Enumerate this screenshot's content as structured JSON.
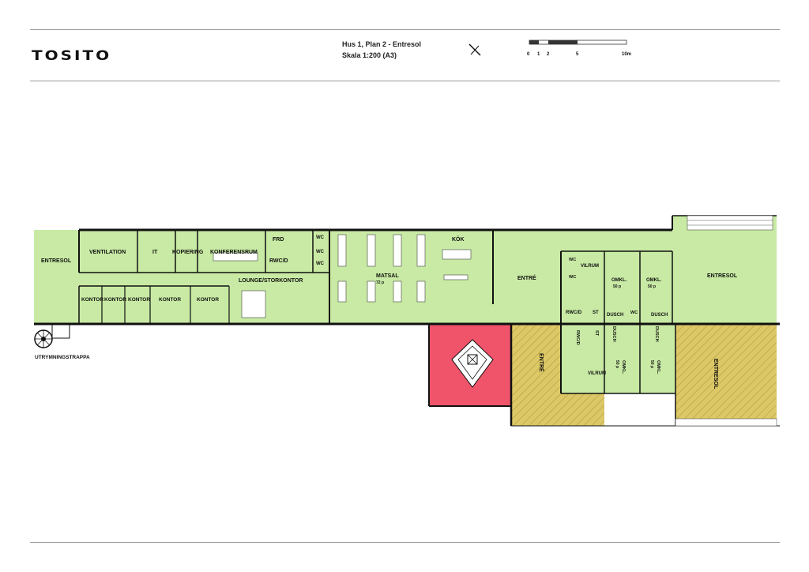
{
  "header": {
    "logo": "TOSITO",
    "title_line1": "Hus 1, Plan 2 - Entresol",
    "title_line2": "Skala 1:200 (A3)",
    "north_icon": "north-arrow-icon",
    "scale_ticks": [
      "0",
      "1",
      "2",
      "5",
      "10m"
    ]
  },
  "colors": {
    "room_fill": "#c8eaa4",
    "stair_fill": "#f0546a",
    "hatched_fill": "#dcc866",
    "wall": "#111111"
  },
  "rooms": {
    "entresol_left": "ENTRESOL",
    "ventilation": "VENTILATION",
    "it": "IT",
    "kopiering": "KOPIERING",
    "konferensrum": "KONFERENSRUM",
    "frd": "FRD",
    "rwcd_1": "RWC/D",
    "wc_1": "WC",
    "wc_2": "WC",
    "wc_3": "WC",
    "kok": "KÖK",
    "matsal": "MATSAL",
    "matsal_cap": "72 p",
    "lounge": "LOUNGE/STORKONTOR",
    "kontor_1": "KONTOR",
    "kontor_2": "KONTOR",
    "kontor_3": "KONTOR",
    "kontor_4": "KONTOR",
    "kontor_5": "KONTOR",
    "entre_top": "ENTRÉ",
    "vilrum_1": "VILRUM",
    "wc_4": "WC",
    "wc_5": "WC",
    "omkl_1": "OMKL.",
    "omkl_1_cap": "50 p",
    "omkl_2": "OMKL.",
    "omkl_2_cap": "50 p",
    "entresol_right": "ENTRESOL",
    "rwcd_2": "RWC/D",
    "st_1": "ST",
    "dusch_1": "DUSCH",
    "wc_6": "WC",
    "dusch_2": "DUSCH",
    "rwcd_3": "RWC/D",
    "st_2": "ST",
    "dusch_3": "DUSCH",
    "dusch_4": "DUSCH",
    "omkl_3": "OMKL.",
    "omkl_3_cap": "50 p",
    "omkl_4": "OMKL.",
    "omkl_4_cap": "50 p",
    "vilrum_2": "VILRUM",
    "entre_lower": "ENTRÉ",
    "entresol_lower": "ENTRESOL",
    "utrymningstrappa": "UTRYMNINGSTRAPPA"
  }
}
